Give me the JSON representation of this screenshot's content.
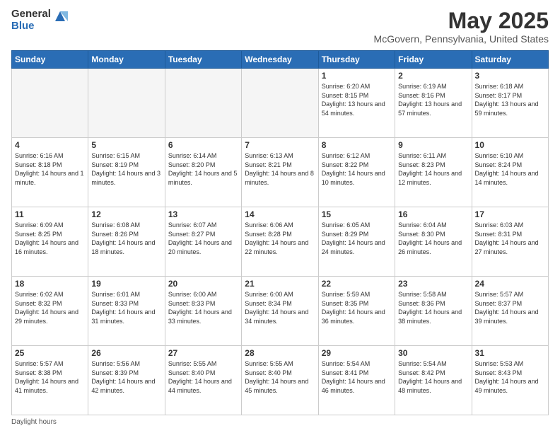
{
  "logo": {
    "general": "General",
    "blue": "Blue"
  },
  "title": "May 2025",
  "subtitle": "McGovern, Pennsylvania, United States",
  "days_of_week": [
    "Sunday",
    "Monday",
    "Tuesday",
    "Wednesday",
    "Thursday",
    "Friday",
    "Saturday"
  ],
  "weeks": [
    [
      {
        "num": "",
        "info": ""
      },
      {
        "num": "",
        "info": ""
      },
      {
        "num": "",
        "info": ""
      },
      {
        "num": "",
        "info": ""
      },
      {
        "num": "1",
        "info": "Sunrise: 6:20 AM\nSunset: 8:15 PM\nDaylight: 13 hours\nand 54 minutes."
      },
      {
        "num": "2",
        "info": "Sunrise: 6:19 AM\nSunset: 8:16 PM\nDaylight: 13 hours\nand 57 minutes."
      },
      {
        "num": "3",
        "info": "Sunrise: 6:18 AM\nSunset: 8:17 PM\nDaylight: 13 hours\nand 59 minutes."
      }
    ],
    [
      {
        "num": "4",
        "info": "Sunrise: 6:16 AM\nSunset: 8:18 PM\nDaylight: 14 hours\nand 1 minute."
      },
      {
        "num": "5",
        "info": "Sunrise: 6:15 AM\nSunset: 8:19 PM\nDaylight: 14 hours\nand 3 minutes."
      },
      {
        "num": "6",
        "info": "Sunrise: 6:14 AM\nSunset: 8:20 PM\nDaylight: 14 hours\nand 5 minutes."
      },
      {
        "num": "7",
        "info": "Sunrise: 6:13 AM\nSunset: 8:21 PM\nDaylight: 14 hours\nand 8 minutes."
      },
      {
        "num": "8",
        "info": "Sunrise: 6:12 AM\nSunset: 8:22 PM\nDaylight: 14 hours\nand 10 minutes."
      },
      {
        "num": "9",
        "info": "Sunrise: 6:11 AM\nSunset: 8:23 PM\nDaylight: 14 hours\nand 12 minutes."
      },
      {
        "num": "10",
        "info": "Sunrise: 6:10 AM\nSunset: 8:24 PM\nDaylight: 14 hours\nand 14 minutes."
      }
    ],
    [
      {
        "num": "11",
        "info": "Sunrise: 6:09 AM\nSunset: 8:25 PM\nDaylight: 14 hours\nand 16 minutes."
      },
      {
        "num": "12",
        "info": "Sunrise: 6:08 AM\nSunset: 8:26 PM\nDaylight: 14 hours\nand 18 minutes."
      },
      {
        "num": "13",
        "info": "Sunrise: 6:07 AM\nSunset: 8:27 PM\nDaylight: 14 hours\nand 20 minutes."
      },
      {
        "num": "14",
        "info": "Sunrise: 6:06 AM\nSunset: 8:28 PM\nDaylight: 14 hours\nand 22 minutes."
      },
      {
        "num": "15",
        "info": "Sunrise: 6:05 AM\nSunset: 8:29 PM\nDaylight: 14 hours\nand 24 minutes."
      },
      {
        "num": "16",
        "info": "Sunrise: 6:04 AM\nSunset: 8:30 PM\nDaylight: 14 hours\nand 26 minutes."
      },
      {
        "num": "17",
        "info": "Sunrise: 6:03 AM\nSunset: 8:31 PM\nDaylight: 14 hours\nand 27 minutes."
      }
    ],
    [
      {
        "num": "18",
        "info": "Sunrise: 6:02 AM\nSunset: 8:32 PM\nDaylight: 14 hours\nand 29 minutes."
      },
      {
        "num": "19",
        "info": "Sunrise: 6:01 AM\nSunset: 8:33 PM\nDaylight: 14 hours\nand 31 minutes."
      },
      {
        "num": "20",
        "info": "Sunrise: 6:00 AM\nSunset: 8:33 PM\nDaylight: 14 hours\nand 33 minutes."
      },
      {
        "num": "21",
        "info": "Sunrise: 6:00 AM\nSunset: 8:34 PM\nDaylight: 14 hours\nand 34 minutes."
      },
      {
        "num": "22",
        "info": "Sunrise: 5:59 AM\nSunset: 8:35 PM\nDaylight: 14 hours\nand 36 minutes."
      },
      {
        "num": "23",
        "info": "Sunrise: 5:58 AM\nSunset: 8:36 PM\nDaylight: 14 hours\nand 38 minutes."
      },
      {
        "num": "24",
        "info": "Sunrise: 5:57 AM\nSunset: 8:37 PM\nDaylight: 14 hours\nand 39 minutes."
      }
    ],
    [
      {
        "num": "25",
        "info": "Sunrise: 5:57 AM\nSunset: 8:38 PM\nDaylight: 14 hours\nand 41 minutes."
      },
      {
        "num": "26",
        "info": "Sunrise: 5:56 AM\nSunset: 8:39 PM\nDaylight: 14 hours\nand 42 minutes."
      },
      {
        "num": "27",
        "info": "Sunrise: 5:55 AM\nSunset: 8:40 PM\nDaylight: 14 hours\nand 44 minutes."
      },
      {
        "num": "28",
        "info": "Sunrise: 5:55 AM\nSunset: 8:40 PM\nDaylight: 14 hours\nand 45 minutes."
      },
      {
        "num": "29",
        "info": "Sunrise: 5:54 AM\nSunset: 8:41 PM\nDaylight: 14 hours\nand 46 minutes."
      },
      {
        "num": "30",
        "info": "Sunrise: 5:54 AM\nSunset: 8:42 PM\nDaylight: 14 hours\nand 48 minutes."
      },
      {
        "num": "31",
        "info": "Sunrise: 5:53 AM\nSunset: 8:43 PM\nDaylight: 14 hours\nand 49 minutes."
      }
    ]
  ],
  "footer": "Daylight hours"
}
